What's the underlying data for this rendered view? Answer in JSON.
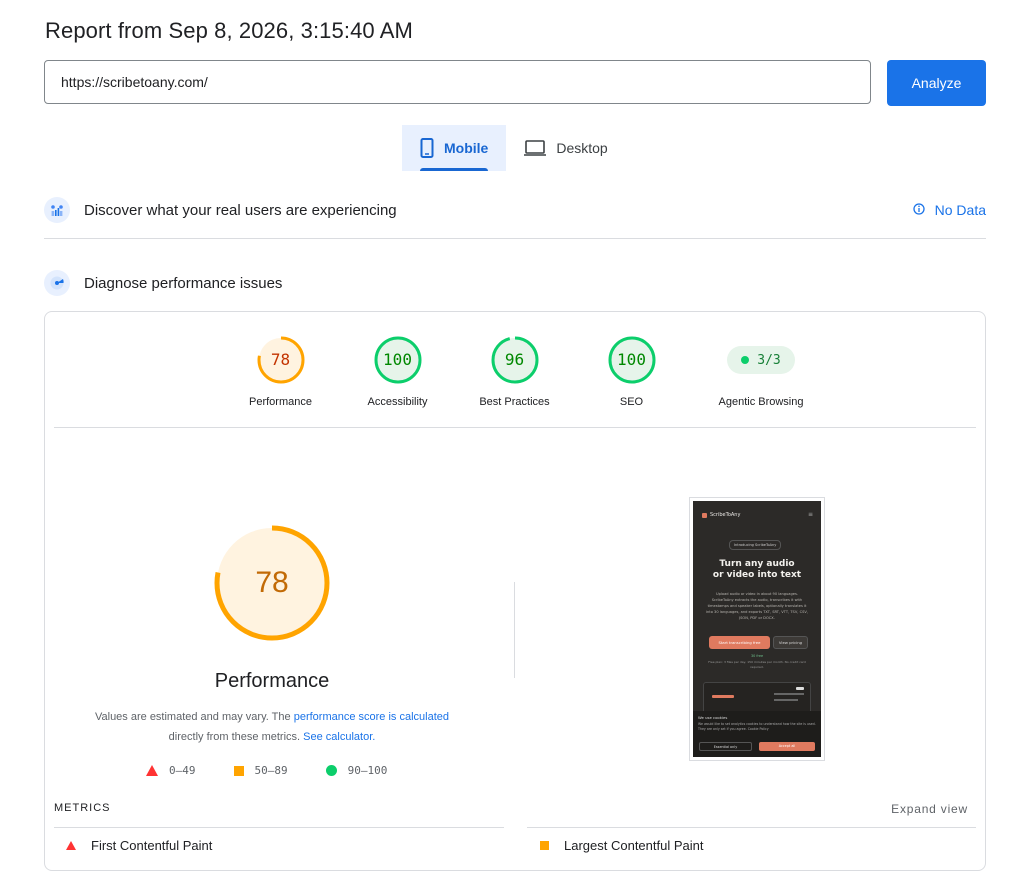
{
  "report": {
    "title": "Report from Sep 8, 2026, 3:15:40 AM"
  },
  "search": {
    "url": "https://scribetoany.com/",
    "analyze_label": "Analyze"
  },
  "device_tabs": [
    {
      "label": "Mobile",
      "icon": "phone-icon",
      "active": true
    },
    {
      "label": "Desktop",
      "icon": "laptop-icon",
      "active": false
    }
  ],
  "crux": {
    "title": "Discover what your real users are experiencing",
    "status": "No Data",
    "icon": "users-chart-icon"
  },
  "diagnose": {
    "title": "Diagnose performance issues",
    "icon": "lighthouse-icon"
  },
  "category_scores": [
    {
      "label": "Performance",
      "score": 78,
      "rating": "average"
    },
    {
      "label": "Accessibility",
      "score": 100,
      "rating": "pass"
    },
    {
      "label": "Best Practices",
      "score": 96,
      "rating": "pass"
    },
    {
      "label": "SEO",
      "score": 100,
      "rating": "pass"
    }
  ],
  "agentic": {
    "label": "Agentic Browsing",
    "value": "3/3"
  },
  "performance": {
    "score": 78,
    "title": "Performance",
    "desc_1": "Values are estimated and may vary. The ",
    "desc_link_1": "performance score is calculated",
    "desc_2": " directly from these metrics. ",
    "desc_link_2": "See calculator."
  },
  "legend": [
    {
      "shape": "triangle",
      "range": "0–49",
      "color": "#ff3333"
    },
    {
      "shape": "square",
      "range": "50–89",
      "color": "#ffa400"
    },
    {
      "shape": "circle",
      "range": "90–100",
      "color": "#0cce6b"
    }
  ],
  "screenshot": {
    "brand": "ScribeToAny",
    "chip": "Introducing ScribeToAny",
    "headline_1": "Turn any audio",
    "headline_2": "or video into text",
    "body": "Upload audio or video in about 90 languages. ScribeToAny extracts the audio, transcribes it with timestamps and speaker labels, optionally translates it into 30 languages, and exports TXT, SRT, VTT, TSV, CSV, JSON, PDF or DOCX.",
    "cta_primary": "Start transcribing free",
    "cta_secondary": "View pricing",
    "free_note": "30 free",
    "plan_note": "Free plan: 3 files per day, 150 minutes per month. No credit card required.",
    "cookie_title": "We use cookies",
    "cookie_text": "We would like to set analytics cookies to understand how the site is used. They are only set if you agree. Cookie Policy",
    "cookie_essential": "Essential only",
    "cookie_accept": "Accept all"
  },
  "metrics": {
    "label": "METRICS",
    "expand": "Expand view",
    "items": [
      {
        "label": "First Contentful Paint",
        "rating": "fail"
      },
      {
        "label": "Largest Contentful Paint",
        "rating": "average"
      }
    ]
  },
  "colors": {
    "accent": "#1a73e8",
    "average": "#ffa400",
    "pass": "#0cce6b",
    "fail": "#ff3333"
  }
}
